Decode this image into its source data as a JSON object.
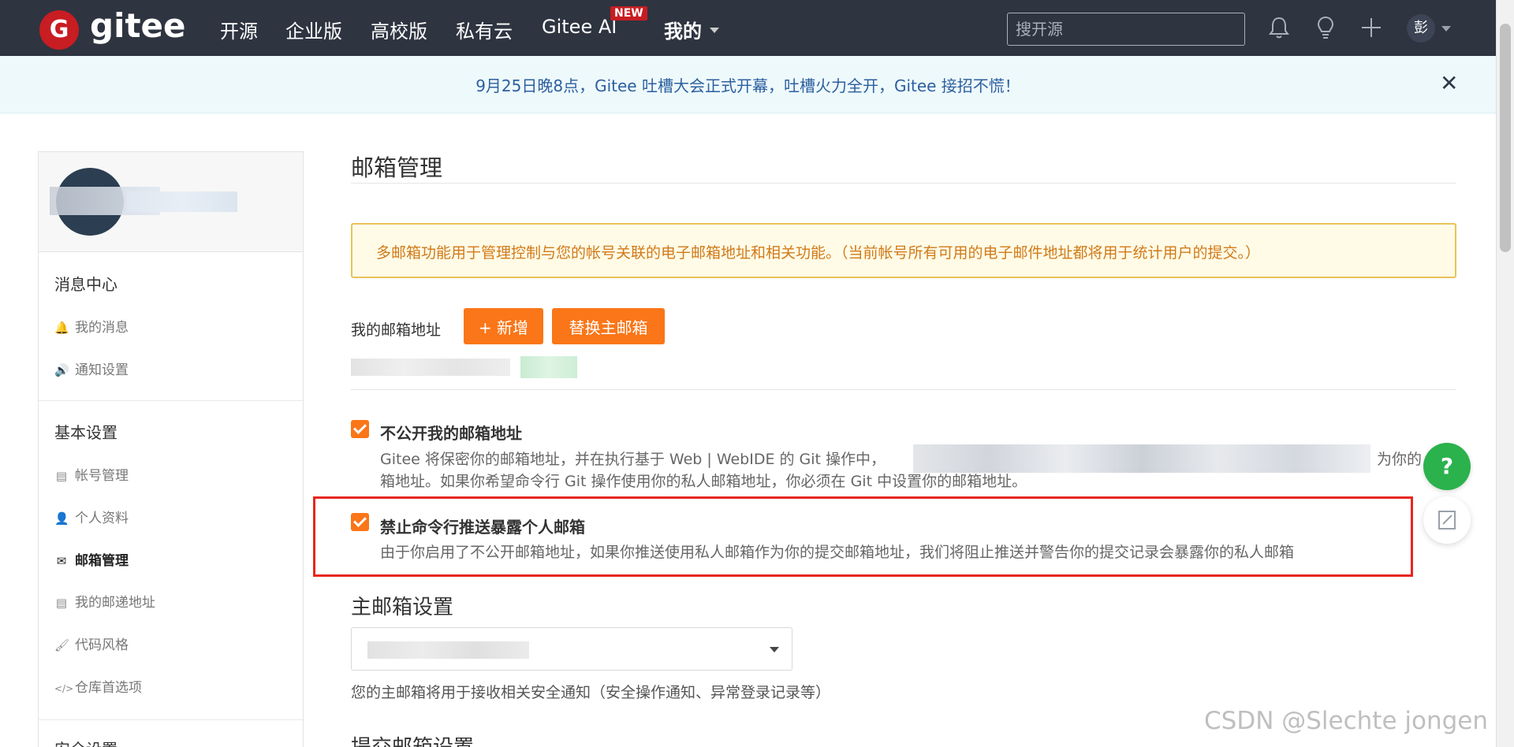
{
  "header": {
    "logo_letter": "G",
    "logo_text": "gitee",
    "nav": [
      "开源",
      "企业版",
      "高校版",
      "私有云",
      "Gitee AI"
    ],
    "new_badge": "NEW",
    "mine_label": "我的",
    "search_placeholder": "搜开源",
    "avatar_text": "彭",
    "icons": [
      "bell-icon",
      "lightbulb-icon",
      "plus-icon"
    ]
  },
  "announcement": {
    "text": "9月25日晚8点，Gitee 吐槽大会正式开幕，吐槽火力全开，Gitee 接招不慌！",
    "close": "✕"
  },
  "sidebar": {
    "sections": [
      {
        "title": "消息中心",
        "items": [
          {
            "label": "我的消息",
            "icon": "bell-icon",
            "glyph": "🔔"
          },
          {
            "label": "通知设置",
            "icon": "volume-icon",
            "glyph": "🔊"
          }
        ]
      },
      {
        "title": "基本设置",
        "items": [
          {
            "label": "帐号管理",
            "icon": "id-card-icon",
            "glyph": "▤"
          },
          {
            "label": "个人资料",
            "icon": "user-icon",
            "glyph": "👤"
          },
          {
            "label": "邮箱管理",
            "icon": "envelope-icon",
            "glyph": "✉",
            "active": true
          },
          {
            "label": "我的邮递地址",
            "icon": "address-card-icon",
            "glyph": "▤"
          },
          {
            "label": "代码风格",
            "icon": "brush-icon",
            "glyph": "🖌"
          },
          {
            "label": "仓库首选项",
            "icon": "code-icon",
            "glyph": "</>"
          }
        ]
      },
      {
        "title": "安全设置",
        "items": []
      }
    ]
  },
  "main": {
    "title": "邮箱管理",
    "notice": "多邮箱功能用于管理控制与您的帐号关联的电子邮箱地址和相关功能。（当前帐号所有可用的电子邮件地址都将用于统计用户的提交。）",
    "my_email_label": "我的邮箱地址",
    "add_button": "+ 新增",
    "replace_button": "替换主邮箱",
    "options": [
      {
        "title": "不公开我的邮箱地址",
        "desc_line1_start": "Gitee 将保密你的邮箱地址，并在执行基于 Web | WebIDE 的 Git 操作中，",
        "desc_line1_end": "为你的",
        "desc_line2": "箱地址。如果你希望命令行 Git 操作使用你的私人邮箱地址，你必须在 Git 中设置你的邮箱地址。",
        "checked": true
      },
      {
        "title": "禁止命令行推送暴露个人邮箱",
        "desc": "由于你启用了不公开邮箱地址，如果你推送使用私人邮箱作为你的提交邮箱地址，我们将阻止推送并警告你的提交记录会暴露你的私人邮箱",
        "checked": true
      }
    ],
    "primary_title": "主邮箱设置",
    "primary_hint": "您的主邮箱将用于接收相关安全通知（安全操作通知、异常登录记录等）",
    "commit_title": "提交邮箱设置"
  },
  "floating": {
    "help": "?",
    "edit_icon": "edit-icon"
  },
  "watermark": "CSDN @Slechte jongen",
  "colors": {
    "nav_bg": "#2e3440",
    "brand": "#c71d23",
    "accent": "#fa7618",
    "help": "#2bb24c",
    "highlight": "#e8261f"
  }
}
